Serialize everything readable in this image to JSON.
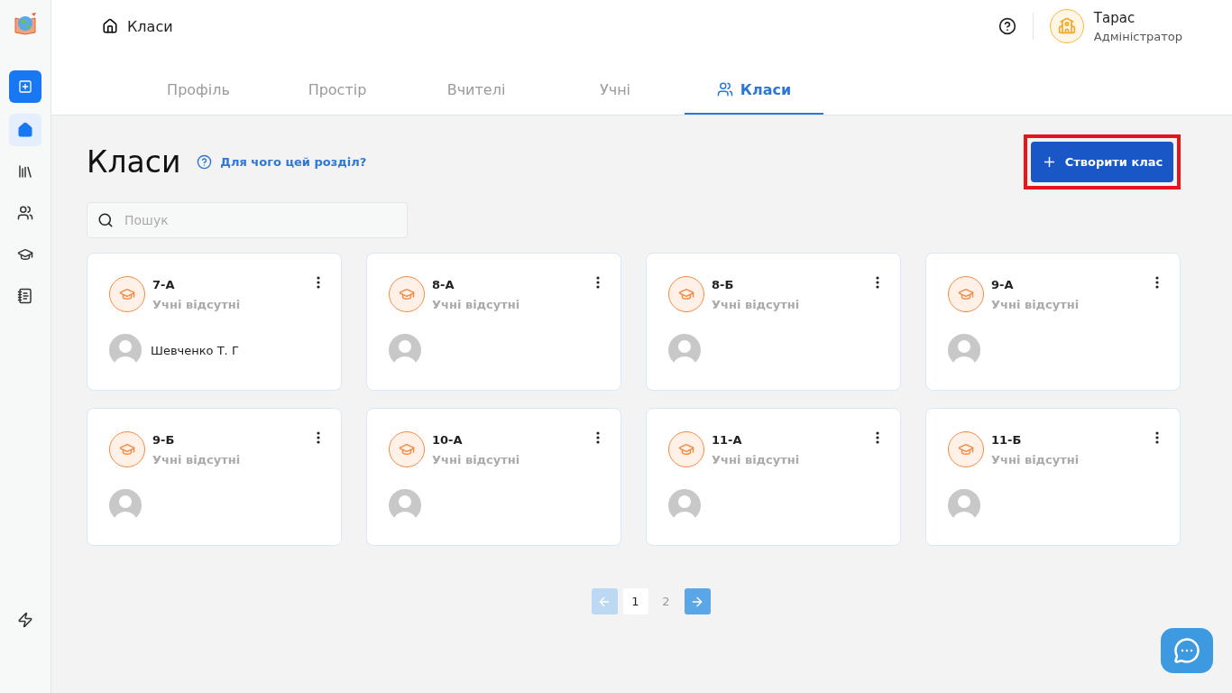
{
  "sidebar": {
    "items": [
      {
        "selected": true
      },
      {
        "selected": false
      },
      {
        "selected": false
      },
      {
        "selected": false
      },
      {
        "selected": false
      }
    ]
  },
  "header": {
    "breadcrumb": "Класи",
    "user": {
      "name": "Тарас",
      "role": "Адміністратор"
    }
  },
  "tabs": [
    {
      "label": "Профіль",
      "selected": false
    },
    {
      "label": "Простір",
      "selected": false
    },
    {
      "label": "Вчителі",
      "selected": false
    },
    {
      "label": "Учні",
      "selected": false
    },
    {
      "label": "Класи",
      "selected": true
    }
  ],
  "page": {
    "title": "Класи",
    "help_link": "Для чого цей розділ?",
    "create_button": "Створити клас",
    "highlighted": true
  },
  "search": {
    "placeholder": "Пошук"
  },
  "classes": [
    {
      "name": "7-А",
      "status": "Учні відсутні",
      "teacher": "Шевченко Т. Г"
    },
    {
      "name": "8-А",
      "status": "Учні відсутні"
    },
    {
      "name": "8-Б",
      "status": "Учні відсутні"
    },
    {
      "name": "9-А",
      "status": "Учні відсутні"
    },
    {
      "name": "9-Б",
      "status": "Учні відсутні"
    },
    {
      "name": "10-А",
      "status": "Учні відсутні"
    },
    {
      "name": "11-А",
      "status": "Учні відсутні"
    },
    {
      "name": "11-Б",
      "status": "Учні відсутні"
    }
  ],
  "pagination": {
    "prev_disabled": true,
    "next_disabled": false,
    "pages": [
      {
        "label": "1",
        "selected": true
      },
      {
        "label": "2",
        "selected": false
      }
    ]
  }
}
